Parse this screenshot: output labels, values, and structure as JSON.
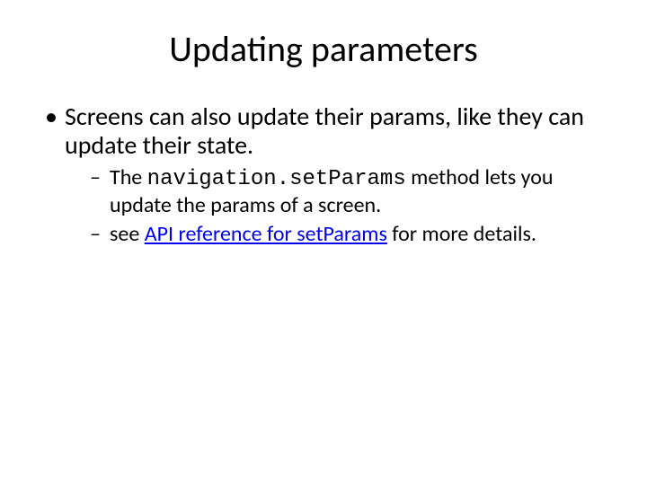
{
  "title": "Updating parameters",
  "bullets": {
    "b1": "Screens can also update their params, like they can update their state.",
    "s1_a": "The ",
    "s1_code": "navigation.setParams",
    "s1_b": " method lets you update the params of a screen.",
    "s2_a": "see ",
    "s2_link": "API reference for setParams",
    "s2_b": " for more details."
  }
}
